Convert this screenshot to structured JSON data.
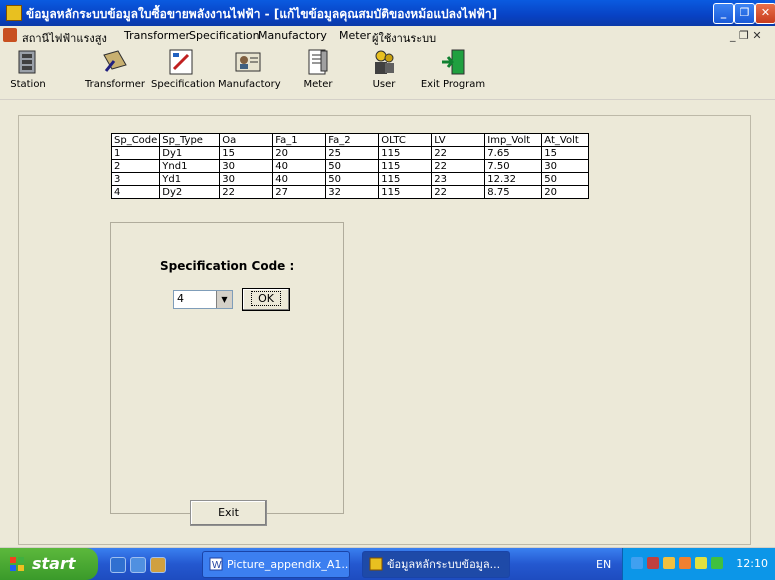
{
  "window": {
    "title": "ข้อมูลหลักระบบข้อมูลใบซื้อขายพลังงานไฟฟ้า - [แก้ไขข้อมูลคุณสมบัติของหม้อแปลงไฟฟ้า]",
    "minimize": "_",
    "restore": "❐",
    "close": "✕"
  },
  "menu": {
    "items": [
      "สถานีไฟฟ้าแรงสูง",
      "Transformer",
      "Specification",
      "Manufactory",
      "Meter",
      "ผู้ใช้งานระบบ"
    ],
    "mdi_controls": "_ ❐ ✕"
  },
  "toolbar": {
    "buttons": [
      {
        "label": "Station",
        "icon": "station-icon"
      },
      {
        "label": "Transformer",
        "icon": "transformer-icon"
      },
      {
        "label": "Specification",
        "icon": "specification-icon"
      },
      {
        "label": "Manufactory",
        "icon": "manufactory-icon"
      },
      {
        "label": "Meter",
        "icon": "meter-icon"
      },
      {
        "label": "User",
        "icon": "user-icon"
      },
      {
        "label": "Exit Program",
        "icon": "exit-program-icon"
      }
    ]
  },
  "table": {
    "columns": [
      "Sp_Code",
      "Sp_Type",
      "Oa",
      "Fa_1",
      "Fa_2",
      "OLTC",
      "LV",
      "Imp_Volt",
      "At_Volt"
    ],
    "rows": [
      [
        "1",
        "Dy1",
        "15",
        "20",
        "25",
        "115",
        "22",
        "7.65",
        "15"
      ],
      [
        "2",
        "Ynd1",
        "30",
        "40",
        "50",
        "115",
        "22",
        "7.50",
        "30"
      ],
      [
        "3",
        "Yd1",
        "30",
        "40",
        "50",
        "115",
        "23",
        "12.32",
        "50"
      ],
      [
        "4",
        "Dy2",
        "22",
        "27",
        "32",
        "115",
        "22",
        "8.75",
        "20"
      ]
    ]
  },
  "form": {
    "spec_label": "Specification Code :",
    "selected_code": "4",
    "ok_label": "OK",
    "exit_label": "Exit"
  },
  "taskbar": {
    "start_label": "start",
    "items": [
      "Picture_appendix_A1...",
      "ข้อมูลหลักระบบข้อมูล..."
    ],
    "language": "EN",
    "clock": "12:10"
  }
}
